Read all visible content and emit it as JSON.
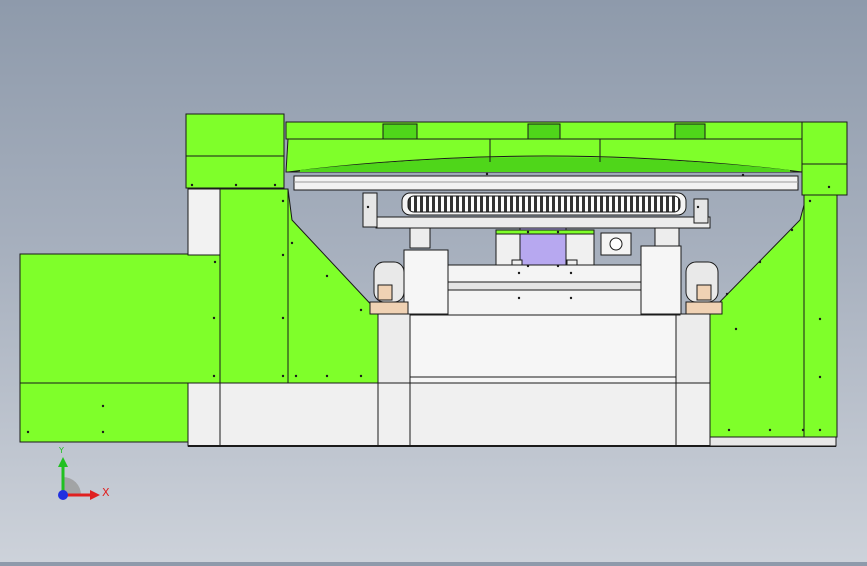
{
  "view": {
    "type": "cad-viewport",
    "model": "machine-assembly-front-view",
    "colors": {
      "background_top": "#8e9aab",
      "background_bottom": "#cdd2da",
      "frame_green": "#7fff2a",
      "frame_green_dark": "#4fd61a",
      "steel_white": "#f2f2f2",
      "steel_grey": "#d7d7d7",
      "bracket_tan": "#f0d2b4",
      "plate_lavender": "#b7a8f0",
      "edge": "#1a1a1a"
    }
  },
  "triad": {
    "x_label": "X",
    "y_label": "Y",
    "x_color": "#e02020",
    "y_color": "#20c020",
    "z_color": "#2030e0"
  }
}
